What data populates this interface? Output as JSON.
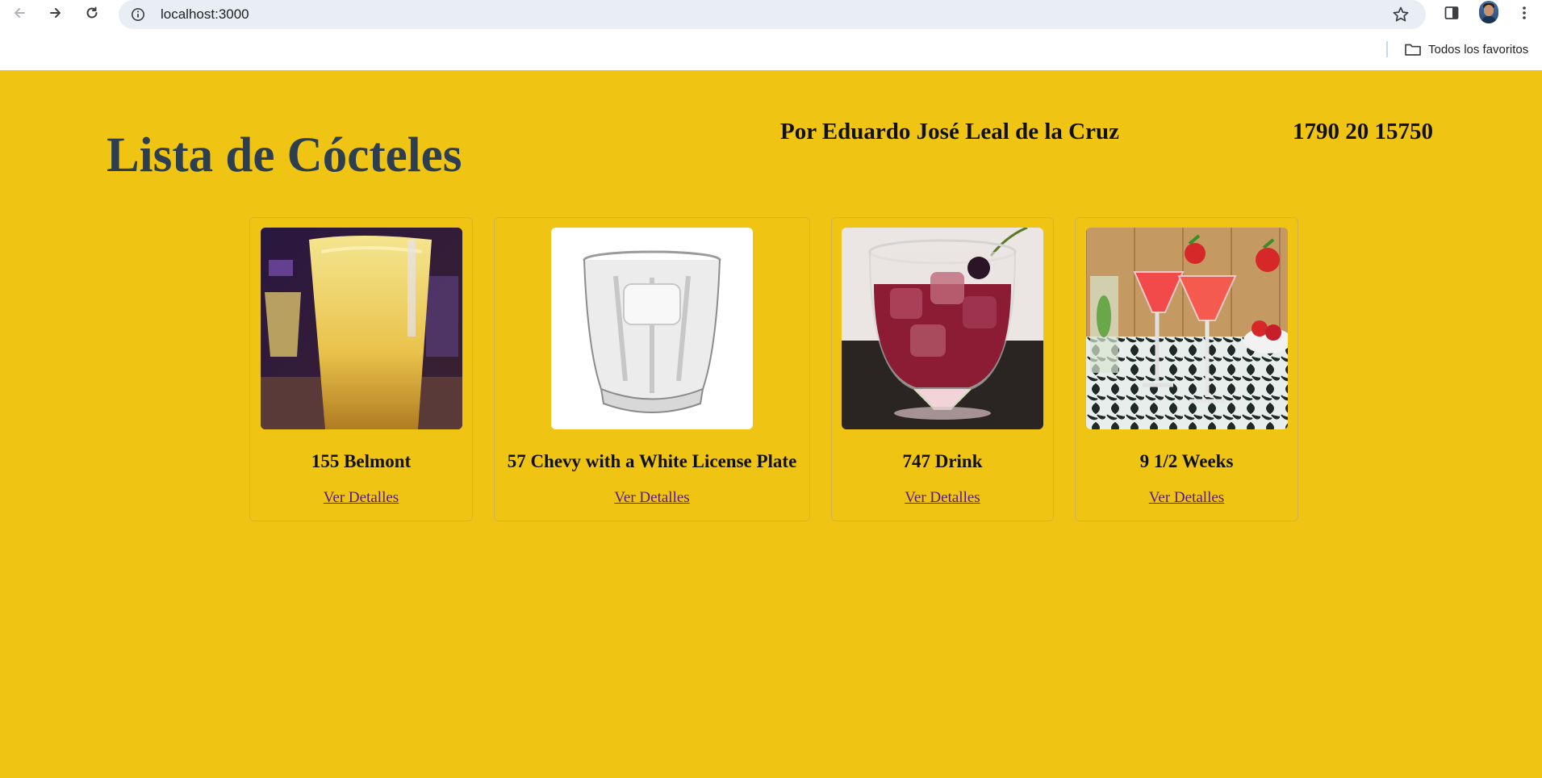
{
  "browser": {
    "url": "localhost:3000",
    "bookmarks_folder": "Todos los favoritos"
  },
  "header": {
    "title": "Lista de Cócteles",
    "author": "Por Eduardo José Leal de la Cruz",
    "id_number": "1790 20 15750"
  },
  "cocktails": [
    {
      "name": "155 Belmont",
      "link": "Ver Detalles"
    },
    {
      "name": "57 Chevy with a White License Plate",
      "link": "Ver Detalles"
    },
    {
      "name": "747 Drink",
      "link": "Ver Detalles"
    },
    {
      "name": "9 1/2 Weeks",
      "link": "Ver Detalles"
    }
  ],
  "colors": {
    "page_background": "#f0c413",
    "title_color": "#2c3e50",
    "link_color": "#551a8b"
  }
}
